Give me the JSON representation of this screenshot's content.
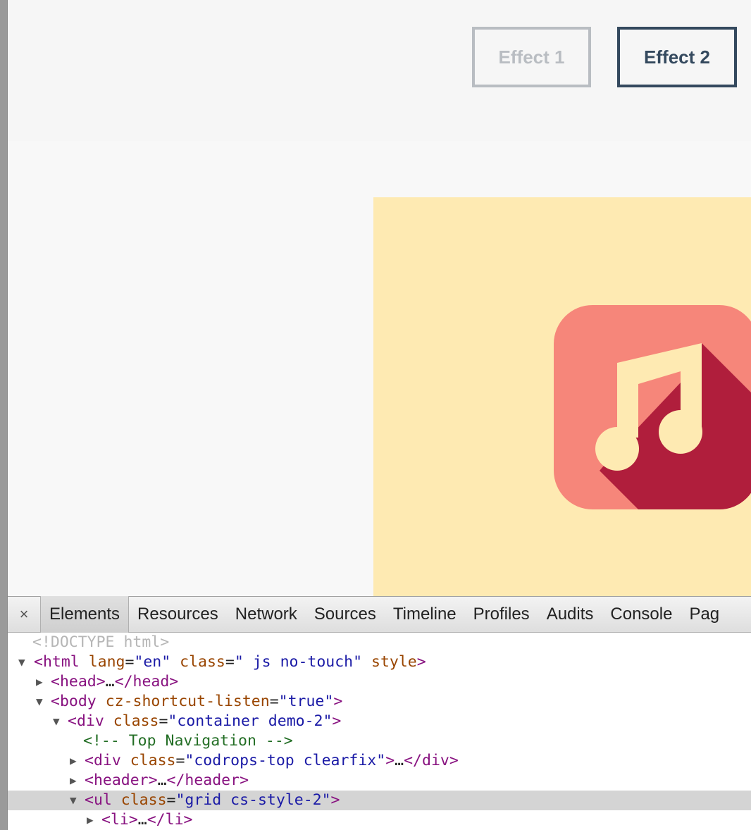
{
  "page": {
    "effects": [
      {
        "label": "Effect 1",
        "active": false
      },
      {
        "label": "Effect 2",
        "active": true
      }
    ],
    "grid_item": {
      "icon": "music-note-icon",
      "background": "#feeab2"
    }
  },
  "devtools": {
    "close_glyph": "×",
    "tabs": [
      "Elements",
      "Resources",
      "Network",
      "Sources",
      "Timeline",
      "Profiles",
      "Audits",
      "Console",
      "Pag"
    ],
    "active_tab": "Elements",
    "tree": {
      "doctype": "<!DOCTYPE html>",
      "html": {
        "open": "<html",
        "attr1": "lang",
        "val1": "\"en\"",
        "attr2": "class",
        "val2": "\" js no-touch\"",
        "attr3": "style",
        "close": ">"
      },
      "head": {
        "open": "<head>",
        "ellipsis": "…",
        "close": "</head>"
      },
      "body": {
        "open": "<body",
        "attr": "cz-shortcut-listen",
        "val": "\"true\"",
        "close": ">"
      },
      "div_container": {
        "open": "<div",
        "attr": "class",
        "val": "\"container demo-2\"",
        "close": ">"
      },
      "comment": "<!-- Top Navigation -->",
      "div_top": {
        "open": "<div",
        "attr": "class",
        "val": "\"codrops-top clearfix\"",
        "mid": ">",
        "ellipsis": "…",
        "close": "</div>"
      },
      "header": {
        "open": "<header>",
        "ellipsis": "…",
        "close": "</header>"
      },
      "ul": {
        "open": "<ul",
        "attr": "class",
        "val": "\"grid cs-style-2\"",
        "close": ">"
      },
      "li": {
        "open": "<li>",
        "ellipsis": "…",
        "close": "</li>"
      }
    }
  },
  "colors": {
    "active_button": "#34495e",
    "inactive_button": "#b9bdc2",
    "card_bg": "#feeab2",
    "icon_salmon": "#f6867a",
    "icon_shadow": "#b01e3c",
    "note": "#feeab2"
  }
}
